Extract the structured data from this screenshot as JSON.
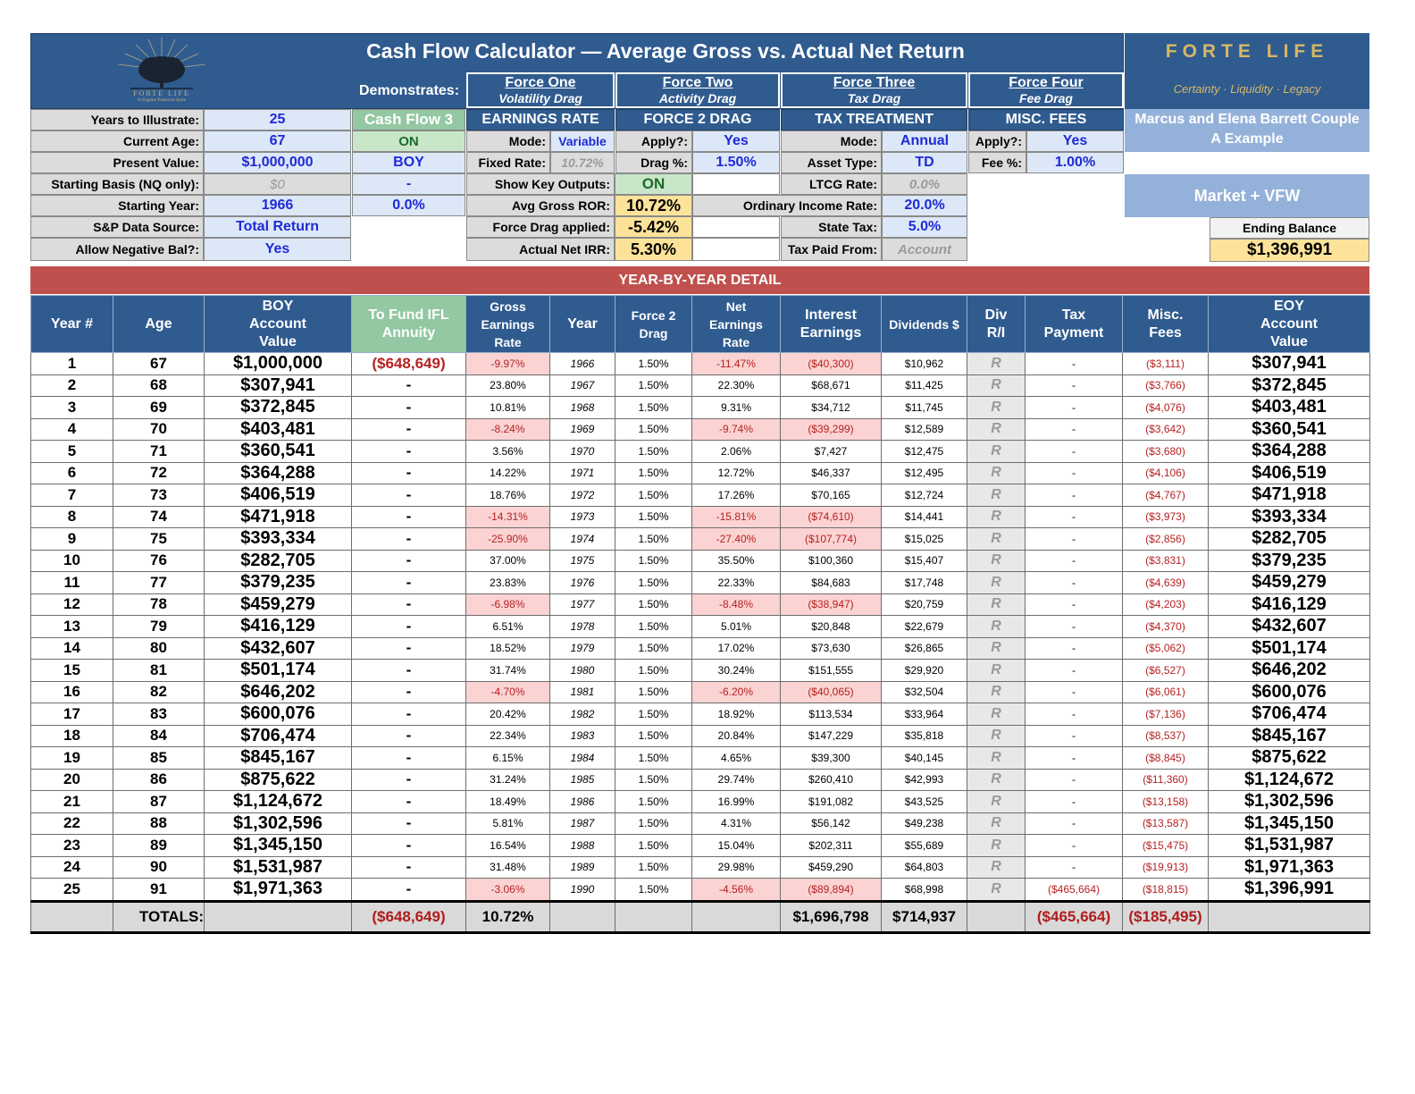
{
  "title": "Cash Flow Calculator — Average Gross vs. Actual Net Return",
  "brand": {
    "name": "FORTE LIFE",
    "tagline": "Certainty · Liquidity · Legacy",
    "logo_text": "FORTE LIFE",
    "logo_sub": "A Singular Financial Space"
  },
  "client": {
    "line1": "Marcus and Elena Barrett Couple",
    "line2": "A Example"
  },
  "demonstrates_label": "Demonstrates:",
  "forces": [
    {
      "title": "Force One",
      "subtitle": "Volatility Drag",
      "section": "EARNINGS RATE"
    },
    {
      "title": "Force Two",
      "subtitle": "Activity Drag",
      "section": "FORCE 2 DRAG"
    },
    {
      "title": "Force Three",
      "subtitle": "Tax Drag",
      "section": "TAX TREATMENT"
    },
    {
      "title": "Force Four",
      "subtitle": "Fee Drag",
      "section": "MISC. FEES"
    }
  ],
  "inputs": {
    "years_label": "Years to Illustrate:",
    "years": "25",
    "age_label": "Current Age:",
    "age": "67",
    "pv_label": "Present Value:",
    "pv": "$1,000,000",
    "basis_label": "Starting Basis (NQ only):",
    "basis": "$0",
    "start_year_label": "Starting Year:",
    "start_year": "1966",
    "sp_label": "S&P Data Source:",
    "sp": "Total Return",
    "neg_label": "Allow Negative Bal?:",
    "neg": "Yes"
  },
  "cashflow": {
    "title": "Cash Flow 3",
    "status": "ON",
    "timing": "BOY",
    "dash": "-",
    "rate": "0.0%"
  },
  "earnings": {
    "mode_label": "Mode:",
    "mode": "Variable",
    "fixed_label": "Fixed Rate:",
    "fixed": "10.72%",
    "show_label": "Show Key Outputs:",
    "show": "ON",
    "avg_label": "Avg Gross ROR:",
    "avg": "10.72%",
    "drag_applied_label": "Force Drag applied:",
    "drag_applied": "-5.42%",
    "irr_label": "Actual Net IRR:",
    "irr": "5.30%"
  },
  "force2": {
    "apply_label": "Apply?:",
    "apply": "Yes",
    "drag_label": "Drag %:",
    "drag": "1.50%"
  },
  "tax": {
    "mode_label": "Mode:",
    "mode": "Annual",
    "asset_label": "Asset Type:",
    "asset": "TD",
    "ltcg_label": "LTCG Rate:",
    "ltcg": "0.0%",
    "ord_label": "Ordinary Income Rate:",
    "ord": "20.0%",
    "state_label": "State Tax:",
    "state": "5.0%",
    "paid_label": "Tax Paid From:",
    "paid": "Account"
  },
  "fees": {
    "apply_label": "Apply?:",
    "apply": "Yes",
    "fee_label": "Fee %:",
    "fee": "1.00%"
  },
  "scenario": "Market + VFW",
  "ending": {
    "label": "Ending Balance",
    "value": "$1,396,991"
  },
  "detail_title": "YEAR-BY-YEAR DETAIL",
  "columns": [
    "Year #",
    "Age",
    "BOY Account Value",
    "To Fund IFL Annuity",
    "Gross Earnings Rate",
    "Year",
    "Force 2 Drag",
    "Net Earnings Rate",
    "Interest Earnings",
    "Dividends $",
    "Div R/I",
    "Tax Payment",
    "Misc. Fees",
    "EOY Account Value"
  ],
  "rows": [
    [
      "1",
      "67",
      "$1,000,000",
      "($648,649)",
      "-9.97%",
      "1966",
      "1.50%",
      "-11.47%",
      "($40,300)",
      "$10,962",
      "R",
      "-",
      "($3,111)",
      "$307,941"
    ],
    [
      "2",
      "68",
      "$307,941",
      "-",
      "23.80%",
      "1967",
      "1.50%",
      "22.30%",
      "$68,671",
      "$11,425",
      "R",
      "-",
      "($3,766)",
      "$372,845"
    ],
    [
      "3",
      "69",
      "$372,845",
      "-",
      "10.81%",
      "1968",
      "1.50%",
      "9.31%",
      "$34,712",
      "$11,745",
      "R",
      "-",
      "($4,076)",
      "$403,481"
    ],
    [
      "4",
      "70",
      "$403,481",
      "-",
      "-8.24%",
      "1969",
      "1.50%",
      "-9.74%",
      "($39,299)",
      "$12,589",
      "R",
      "-",
      "($3,642)",
      "$360,541"
    ],
    [
      "5",
      "71",
      "$360,541",
      "-",
      "3.56%",
      "1970",
      "1.50%",
      "2.06%",
      "$7,427",
      "$12,475",
      "R",
      "-",
      "($3,680)",
      "$364,288"
    ],
    [
      "6",
      "72",
      "$364,288",
      "-",
      "14.22%",
      "1971",
      "1.50%",
      "12.72%",
      "$46,337",
      "$12,495",
      "R",
      "-",
      "($4,106)",
      "$406,519"
    ],
    [
      "7",
      "73",
      "$406,519",
      "-",
      "18.76%",
      "1972",
      "1.50%",
      "17.26%",
      "$70,165",
      "$12,724",
      "R",
      "-",
      "($4,767)",
      "$471,918"
    ],
    [
      "8",
      "74",
      "$471,918",
      "-",
      "-14.31%",
      "1973",
      "1.50%",
      "-15.81%",
      "($74,610)",
      "$14,441",
      "R",
      "-",
      "($3,973)",
      "$393,334"
    ],
    [
      "9",
      "75",
      "$393,334",
      "-",
      "-25.90%",
      "1974",
      "1.50%",
      "-27.40%",
      "($107,774)",
      "$15,025",
      "R",
      "-",
      "($2,856)",
      "$282,705"
    ],
    [
      "10",
      "76",
      "$282,705",
      "-",
      "37.00%",
      "1975",
      "1.50%",
      "35.50%",
      "$100,360",
      "$15,407",
      "R",
      "-",
      "($3,831)",
      "$379,235"
    ],
    [
      "11",
      "77",
      "$379,235",
      "-",
      "23.83%",
      "1976",
      "1.50%",
      "22.33%",
      "$84,683",
      "$17,748",
      "R",
      "-",
      "($4,639)",
      "$459,279"
    ],
    [
      "12",
      "78",
      "$459,279",
      "-",
      "-6.98%",
      "1977",
      "1.50%",
      "-8.48%",
      "($38,947)",
      "$20,759",
      "R",
      "-",
      "($4,203)",
      "$416,129"
    ],
    [
      "13",
      "79",
      "$416,129",
      "-",
      "6.51%",
      "1978",
      "1.50%",
      "5.01%",
      "$20,848",
      "$22,679",
      "R",
      "-",
      "($4,370)",
      "$432,607"
    ],
    [
      "14",
      "80",
      "$432,607",
      "-",
      "18.52%",
      "1979",
      "1.50%",
      "17.02%",
      "$73,630",
      "$26,865",
      "R",
      "-",
      "($5,062)",
      "$501,174"
    ],
    [
      "15",
      "81",
      "$501,174",
      "-",
      "31.74%",
      "1980",
      "1.50%",
      "30.24%",
      "$151,555",
      "$29,920",
      "R",
      "-",
      "($6,527)",
      "$646,202"
    ],
    [
      "16",
      "82",
      "$646,202",
      "-",
      "-4.70%",
      "1981",
      "1.50%",
      "-6.20%",
      "($40,065)",
      "$32,504",
      "R",
      "-",
      "($6,061)",
      "$600,076"
    ],
    [
      "17",
      "83",
      "$600,076",
      "-",
      "20.42%",
      "1982",
      "1.50%",
      "18.92%",
      "$113,534",
      "$33,964",
      "R",
      "-",
      "($7,136)",
      "$706,474"
    ],
    [
      "18",
      "84",
      "$706,474",
      "-",
      "22.34%",
      "1983",
      "1.50%",
      "20.84%",
      "$147,229",
      "$35,818",
      "R",
      "-",
      "($8,537)",
      "$845,167"
    ],
    [
      "19",
      "85",
      "$845,167",
      "-",
      "6.15%",
      "1984",
      "1.50%",
      "4.65%",
      "$39,300",
      "$40,145",
      "R",
      "-",
      "($8,845)",
      "$875,622"
    ],
    [
      "20",
      "86",
      "$875,622",
      "-",
      "31.24%",
      "1985",
      "1.50%",
      "29.74%",
      "$260,410",
      "$42,993",
      "R",
      "-",
      "($11,360)",
      "$1,124,672"
    ],
    [
      "21",
      "87",
      "$1,124,672",
      "-",
      "18.49%",
      "1986",
      "1.50%",
      "16.99%",
      "$191,082",
      "$43,525",
      "R",
      "-",
      "($13,158)",
      "$1,302,596"
    ],
    [
      "22",
      "88",
      "$1,302,596",
      "-",
      "5.81%",
      "1987",
      "1.50%",
      "4.31%",
      "$56,142",
      "$49,238",
      "R",
      "-",
      "($13,587)",
      "$1,345,150"
    ],
    [
      "23",
      "89",
      "$1,345,150",
      "-",
      "16.54%",
      "1988",
      "1.50%",
      "15.04%",
      "$202,311",
      "$55,689",
      "R",
      "-",
      "($15,475)",
      "$1,531,987"
    ],
    [
      "24",
      "90",
      "$1,531,987",
      "-",
      "31.48%",
      "1989",
      "1.50%",
      "29.98%",
      "$459,290",
      "$64,803",
      "R",
      "-",
      "($19,913)",
      "$1,971,363"
    ],
    [
      "25",
      "91",
      "$1,971,363",
      "-",
      "-3.06%",
      "1990",
      "1.50%",
      "-4.56%",
      "($89,894)",
      "$68,998",
      "R",
      "($465,664)",
      "($18,815)",
      "$1,396,991"
    ]
  ],
  "totals": {
    "label": "TOTALS:",
    "fund": "($648,649)",
    "gross": "10.72%",
    "interest": "$1,696,798",
    "dividends": "$714,937",
    "tax": "($465,664)",
    "fees": "($185,495)"
  }
}
